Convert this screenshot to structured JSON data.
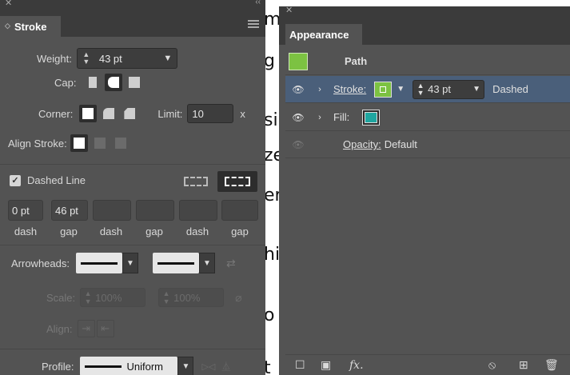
{
  "background_text": [
    "m",
    "g",
    "si",
    "ze",
    "er",
    "hi",
    "o",
    "t"
  ],
  "stroke": {
    "tab_title": "Stroke",
    "weight_label": "Weight:",
    "weight_value": "43 pt",
    "cap_label": "Cap:",
    "corner_label": "Corner:",
    "limit_label": "Limit:",
    "limit_value": "10",
    "limit_unit": "x",
    "align_label": "Align Stroke:",
    "dashed_line_label": "Dashed Line",
    "dashed_line_checked": true,
    "dash_values": [
      "0 pt",
      "46 pt",
      "",
      "",
      "",
      ""
    ],
    "dash_labels": [
      "dash",
      "gap",
      "dash",
      "gap",
      "dash",
      "gap"
    ],
    "arrowheads_label": "Arrowheads:",
    "scale_label": "Scale:",
    "scale_start": "100%",
    "scale_end": "100%",
    "align_arrow_label": "Align:",
    "profile_label": "Profile:",
    "profile_value": "Uniform"
  },
  "appearance": {
    "tab_title": "Appearance",
    "path_label": "Path",
    "stroke_label": "Stroke:",
    "stroke_weight": "43 pt",
    "stroke_style": "Dashed",
    "fill_label": "Fill:",
    "opacity_label": "Opacity:",
    "opacity_value": "Default",
    "fx_label": "fx."
  },
  "colors": {
    "panel": "#535353",
    "stroke_swatch": "#7cc242",
    "fill_swatch": "#1fa6a0",
    "selected_row": "#4a5f7a"
  }
}
